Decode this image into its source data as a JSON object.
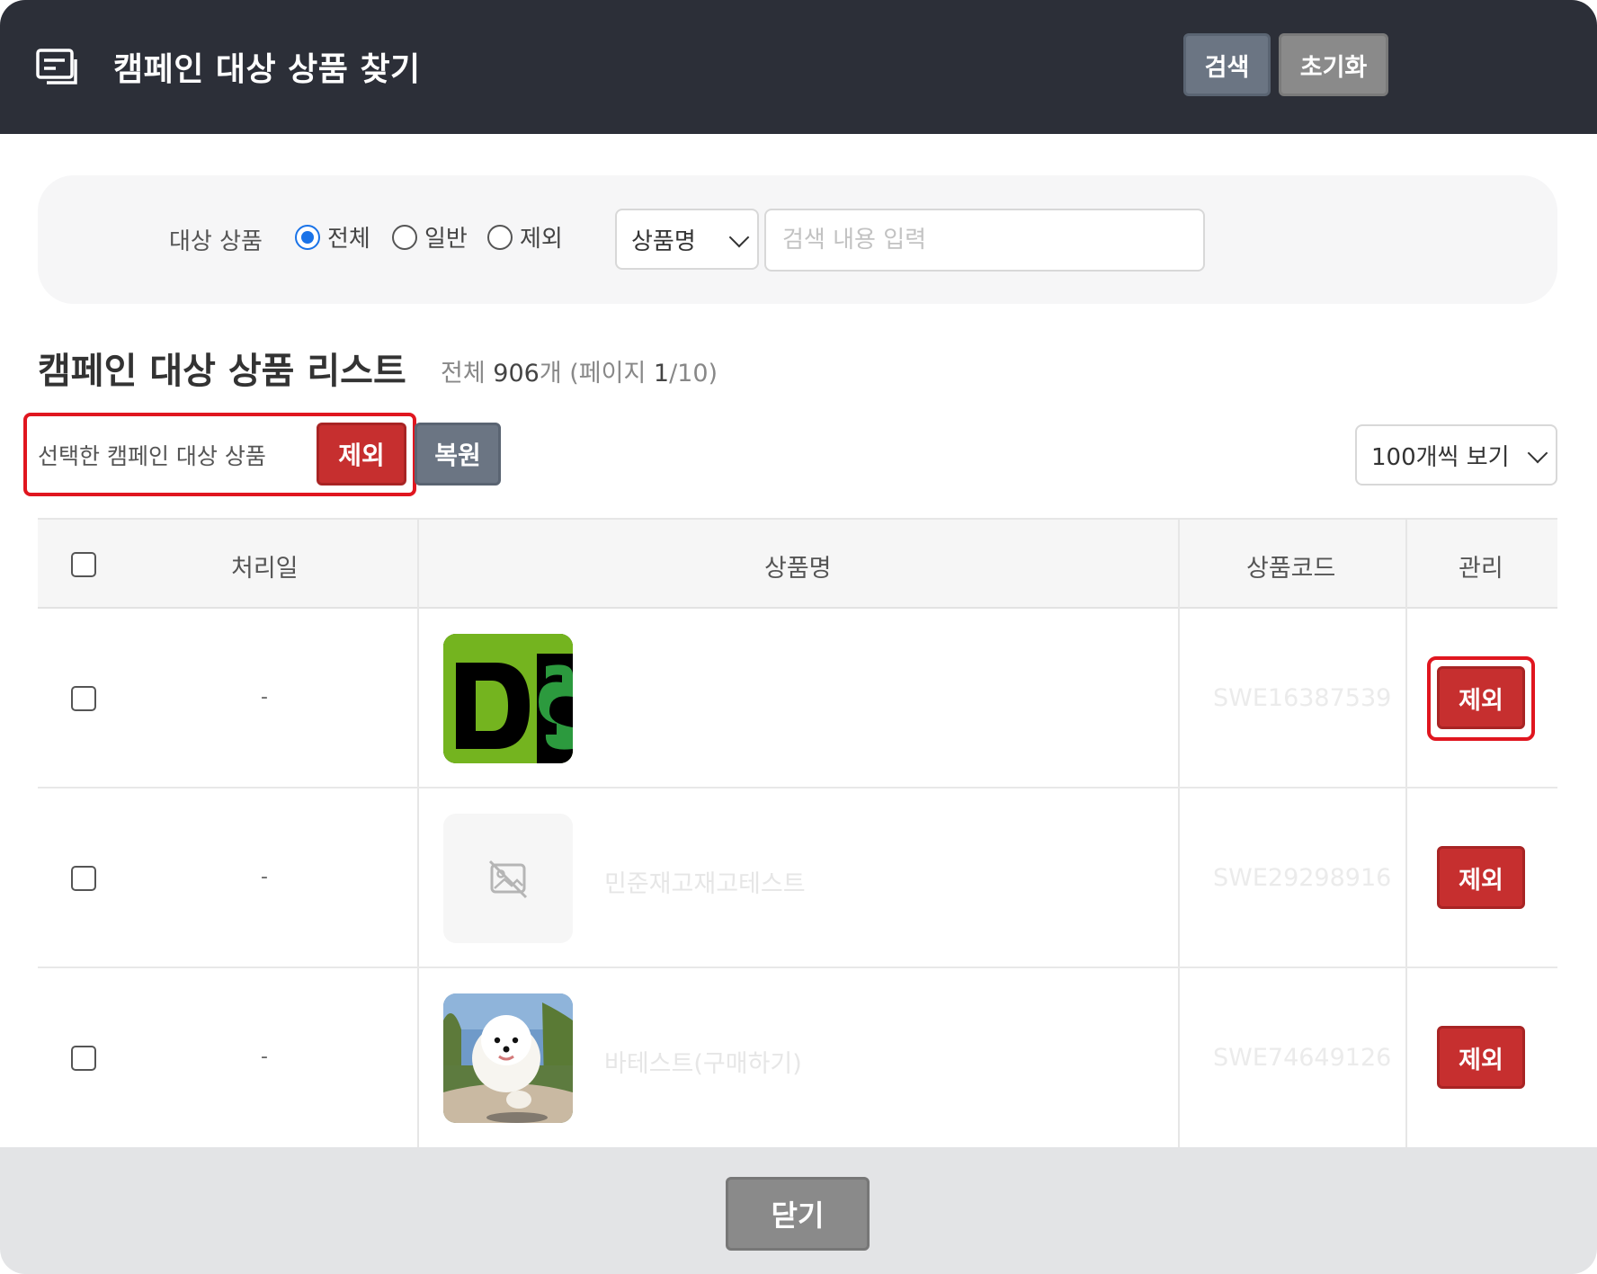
{
  "header": {
    "title": "캠페인 대상 상품 찾기",
    "icon": "message-list-icon"
  },
  "filter": {
    "label": "대상 상품",
    "options": [
      {
        "label": "전체",
        "selected": true
      },
      {
        "label": "일반",
        "selected": false
      },
      {
        "label": "제외",
        "selected": false
      }
    ],
    "field_select": "상품명",
    "search_placeholder": "검색 내용 입력",
    "search_button": "검색",
    "reset_button": "초기화"
  },
  "list": {
    "title": "캠페인 대상 상품 리스트",
    "count_prefix": "전체 ",
    "count_value": "906",
    "count_mid": "개 (페이지 ",
    "page_value": "1",
    "page_suffix": "/10)",
    "selected_label": "선택한 캠페인 대상 상품",
    "exclude_button": "제외",
    "restore_button": "복원",
    "per_page": "100개씩 보기"
  },
  "table": {
    "columns": [
      "처리일",
      "상품명",
      "상품코드",
      "관리"
    ],
    "rows": [
      {
        "date": "-",
        "name": "",
        "code": "SWE16387539",
        "thumb": "ds-logo-image",
        "action": "제외"
      },
      {
        "date": "-",
        "name": "민준재고재고테스트",
        "code": "SWE29298916",
        "thumb": "no-image-icon",
        "action": "제외"
      },
      {
        "date": "-",
        "name": "바테스트(구매하기)",
        "code": "SWE74649126",
        "thumb": "white-dog-photo",
        "action": "제외"
      }
    ]
  },
  "footer": {
    "close_button": "닫기"
  },
  "colors": {
    "header_bg": "#2c2f38",
    "danger": "#c62f2f",
    "primary_gray": "#6b7583",
    "highlight": "#e0161f"
  }
}
